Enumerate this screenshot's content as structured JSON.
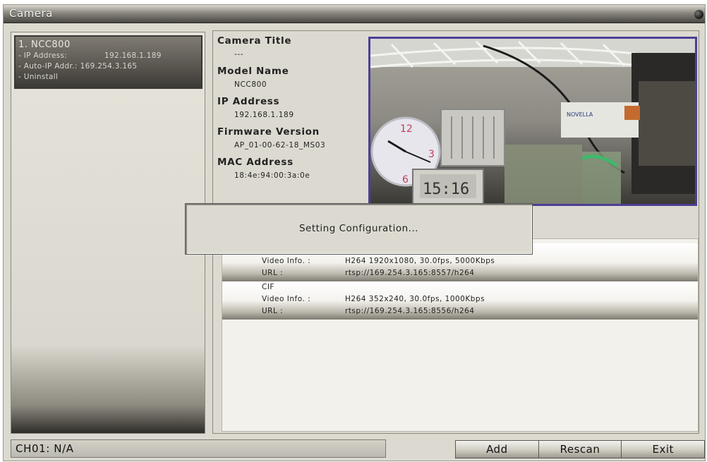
{
  "window": {
    "title": "Camera"
  },
  "devices": [
    {
      "name": "1. NCC800",
      "ip_label": "- IP Address:",
      "ip_value": "192.168.1.189",
      "auto_ip_label": "- Auto-IP Addr.:",
      "auto_ip_value": "169.254.3.165",
      "action": "- Uninstall"
    }
  ],
  "camera_info": {
    "title_label": "Camera Title",
    "title_value": "---",
    "model_label": "Model Name",
    "model_value": "NCC800",
    "ip_label": "IP Address",
    "ip_value": "192.168.1.189",
    "firmware_label": "Firmware Version",
    "firmware_value": "AP_01-00-62-18_MS03",
    "mac_label": "MAC Address",
    "mac_value": "18:4e:94:00:3a:0e"
  },
  "preview": {
    "clock_digits": "15:16",
    "sign_text": "NOVELLA"
  },
  "streams": [
    {
      "name": "",
      "video_label": "Video Info. :",
      "video_value": "H264 1920x1080, 30.0fps, 5000Kbps",
      "url_label": "URL :",
      "url_value": "rtsp://169.254.3.165:8557/h264"
    },
    {
      "name": "CIF",
      "video_label": "Video Info. :",
      "video_value": "H264 352x240, 30.0fps, 1000Kbps",
      "url_label": "URL :",
      "url_value": "rtsp://169.254.3.165:8556/h264"
    }
  ],
  "dialog": {
    "message": "Setting Configuration..."
  },
  "status": {
    "text": "CH01: N/A"
  },
  "buttons": {
    "add": "Add",
    "rescan": "Rescan",
    "exit": "Exit"
  },
  "colors": {
    "preview_border": "#4d3f96",
    "titlebar_dark": "#4a4843",
    "panel_bg": "#dcdad0"
  }
}
